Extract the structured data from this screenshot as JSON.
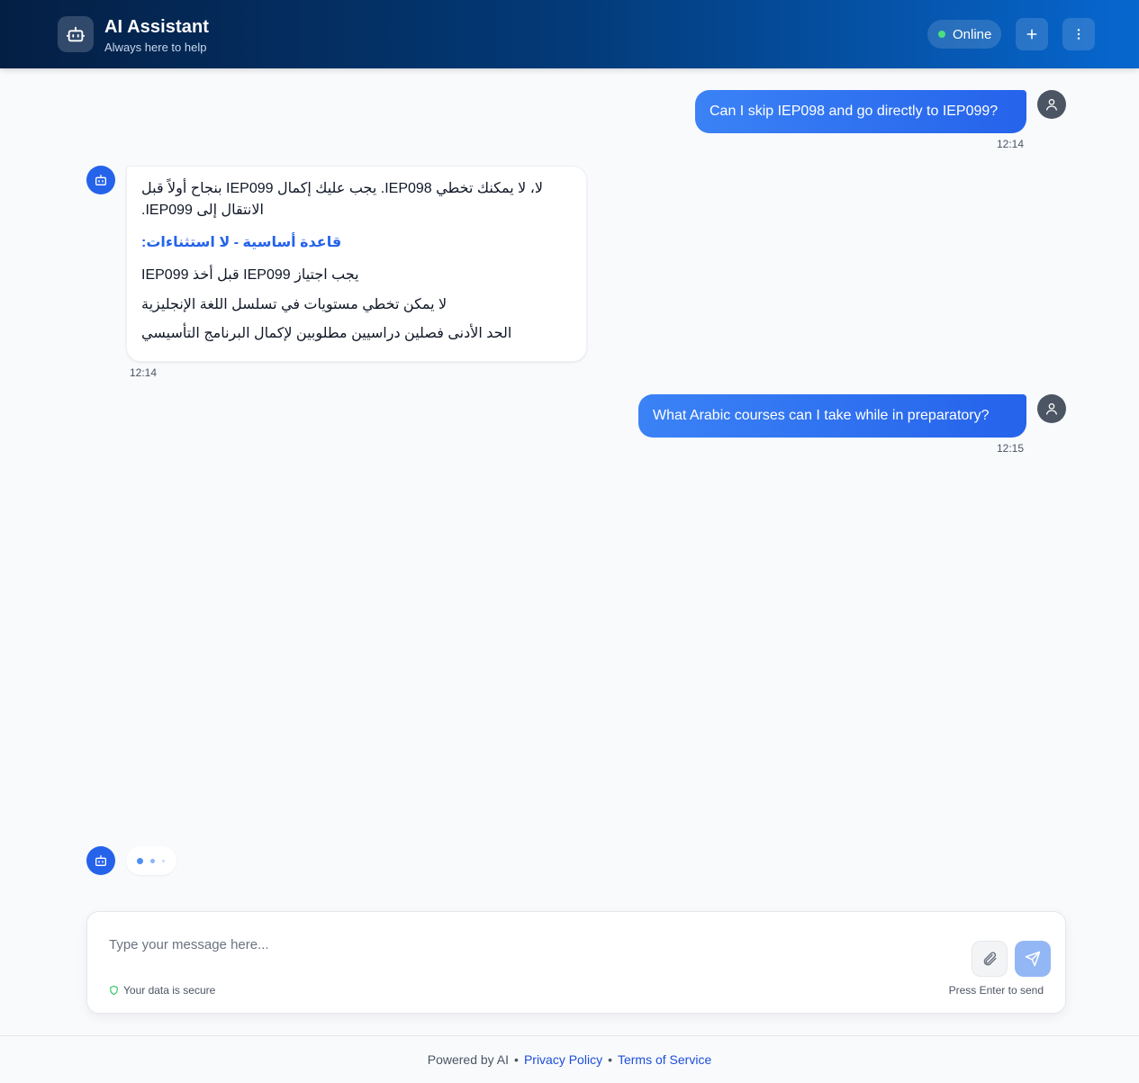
{
  "header": {
    "title": "AI Assistant",
    "subtitle": "Always here to help",
    "status": "Online",
    "status_color": "#4ade80",
    "new_chat_icon": "plus-icon",
    "menu_icon": "more-vertical-icon",
    "logo_icon": "robot-icon"
  },
  "messages": [
    {
      "role": "user",
      "text": "Can I skip IEP098 and go directly to IEP099?",
      "time": "12:14"
    },
    {
      "role": "assistant",
      "lines": [
        "لا، لا يمكنك تخطي IEP098. يجب عليك إكمال IEP099 بنجاح أولاً قبل",
        "الانتقال إلى IEP099."
      ],
      "heading": "قاعدة أساسية - لا استثناءات:",
      "rules": [
        "يجب اجتياز IEP099 قبل أخذ IEP099",
        "لا يمكن تخطي مستويات في تسلسل اللغة الإنجليزية",
        "الحد الأدنى فصلين دراسيين مطلوبين لإكمال البرنامج التأسيسي"
      ],
      "time": "12:14"
    },
    {
      "role": "user",
      "text": "What Arabic courses can I take while in preparatory?",
      "time": "12:15"
    }
  ],
  "composer": {
    "placeholder": "Type your message here...",
    "secure_text": "Your data is secure",
    "hint": "Press Enter to send",
    "attach_icon": "paperclip-icon",
    "send_icon": "send-icon",
    "accent": "#2563eb"
  },
  "footer": {
    "powered": "Powered by AI",
    "sep": "•",
    "privacy": "Privacy Policy",
    "terms": "Terms of Service"
  }
}
